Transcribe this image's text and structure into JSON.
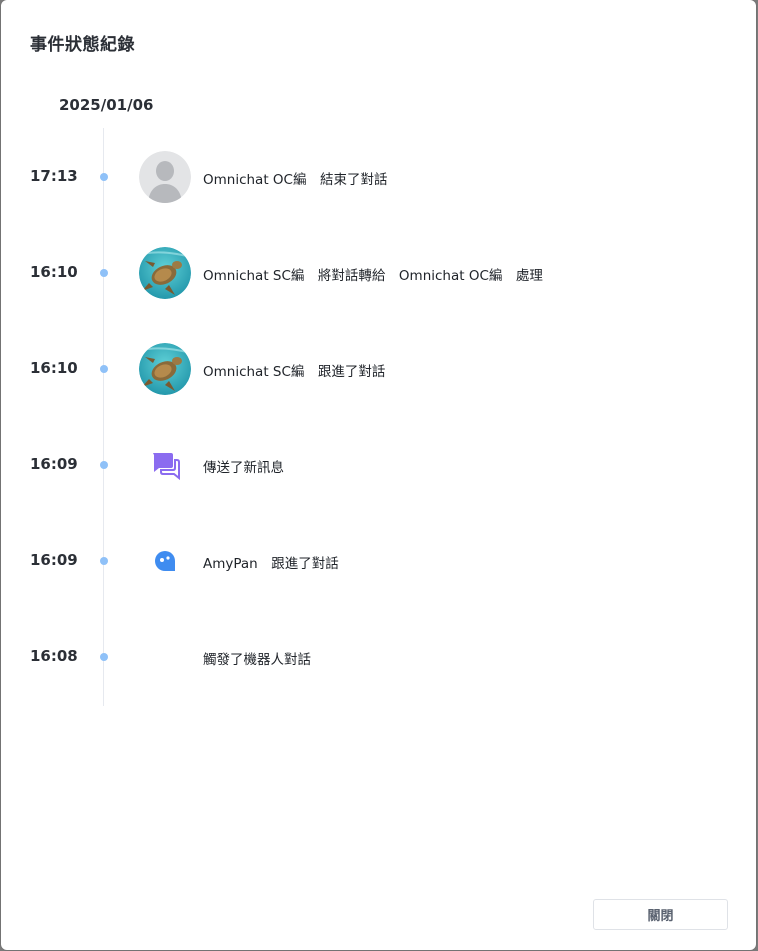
{
  "dialog": {
    "title": "事件狀態紀錄",
    "close_label": "關閉"
  },
  "timeline": {
    "date": "2025/01/06",
    "events": [
      {
        "time": "17:13",
        "description": "Omnichat OC編　結束了對話",
        "avatar": "default-user-avatar"
      },
      {
        "time": "16:10",
        "description": "Omnichat SC編　將對話轉給　Omnichat OC編　處理",
        "avatar": "turtle-photo-avatar"
      },
      {
        "time": "16:10",
        "description": "Omnichat SC編　跟進了對話",
        "avatar": "turtle-photo-avatar"
      },
      {
        "time": "16:09",
        "description": "傳送了新訊息",
        "avatar": "chat-bubbles-icon"
      },
      {
        "time": "16:09",
        "description": "AmyPan　跟進了對話",
        "avatar": "bot-bubble-icon"
      },
      {
        "time": "16:08",
        "description": "觸發了機器人對話",
        "avatar": ""
      }
    ]
  },
  "colors": {
    "timeline_dot": "#8fc1f8",
    "message_icon": "#8b6cf0",
    "bot_icon": "#3f8cf0"
  }
}
